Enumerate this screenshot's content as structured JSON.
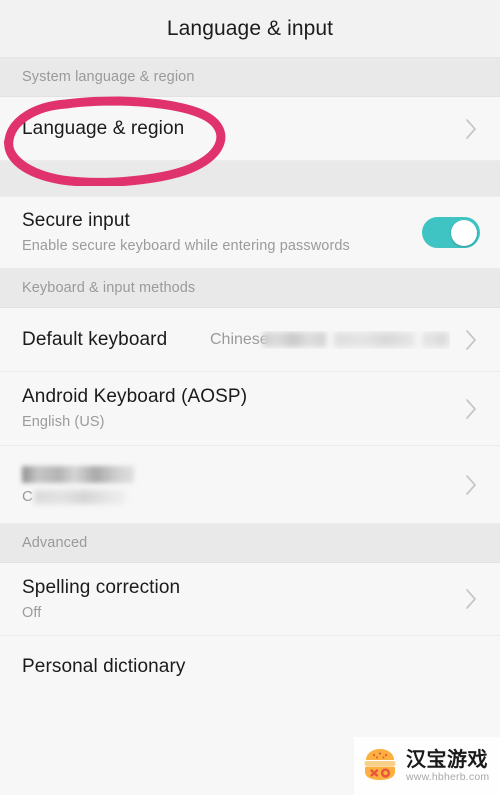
{
  "header": {
    "title": "Language & input"
  },
  "sections": [
    {
      "header": "System language & region",
      "rows": [
        {
          "title": "Language & region",
          "sub": "",
          "value": "",
          "chevron": true
        }
      ]
    },
    {
      "header": "",
      "rows": [
        {
          "title": "Secure input",
          "sub": "Enable secure keyboard while entering passwords",
          "toggle": true,
          "toggle_state": "on"
        }
      ]
    },
    {
      "header": "Keyboard & input methods",
      "rows": [
        {
          "title": "Default keyboard",
          "sub": "",
          "value": "Chinese",
          "value_redacted": true,
          "chevron": true
        },
        {
          "title": "Android Keyboard (AOSP)",
          "sub": "English (US)",
          "value": "",
          "chevron": true
        },
        {
          "title": "",
          "sub": "",
          "redacted_title": true,
          "redacted_sub_lead": "C",
          "chevron": true
        }
      ]
    },
    {
      "header": "Advanced",
      "rows": [
        {
          "title": "Spelling correction",
          "sub": "Off",
          "value": "",
          "chevron": true
        },
        {
          "title": "Personal dictionary",
          "sub": "",
          "value": "",
          "chevron": false
        }
      ]
    }
  ],
  "annotation": {
    "shape": "hand-drawn-ellipse",
    "color": "#e0336e",
    "targets": "Language & region"
  },
  "watermark": {
    "title": "汉宝游戏",
    "url": "www.hbherb.com",
    "icon": "burger-icon"
  },
  "colors": {
    "page_background": "#f7f7f7",
    "section_header_background": "#e9e9e9",
    "toggle_on": "#3fc3c3",
    "primary_text": "#1b1b1b",
    "secondary_text": "#9b9b9b",
    "annotation_pink": "#e0336e"
  }
}
